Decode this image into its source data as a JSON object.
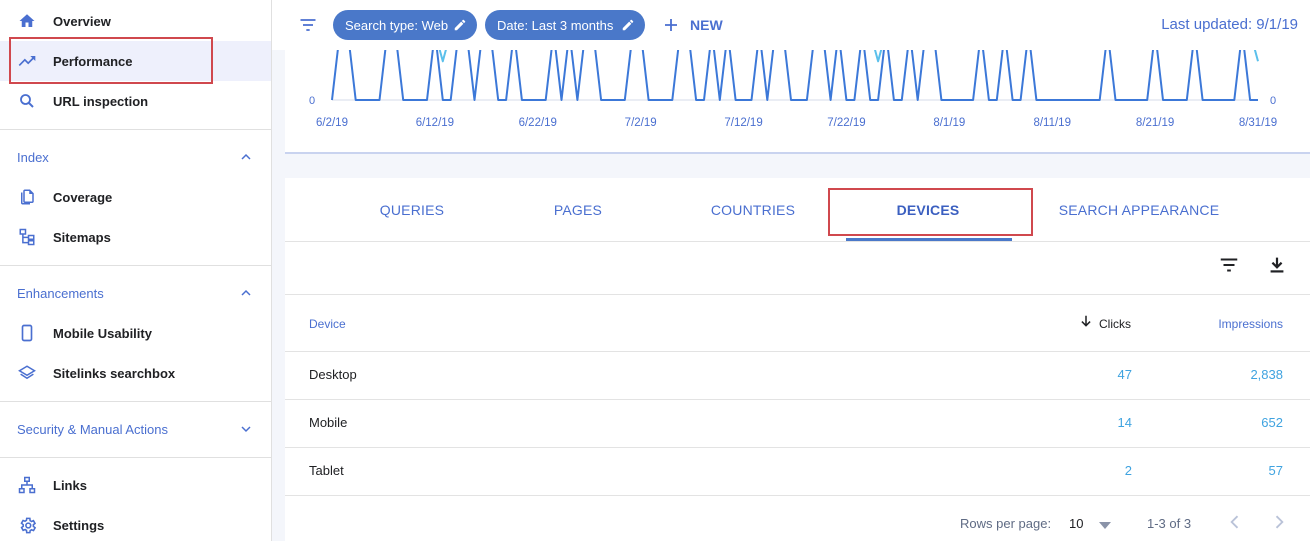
{
  "sidebar": {
    "items": [
      {
        "label": "Overview",
        "icon": "home-icon"
      },
      {
        "label": "Performance",
        "icon": "trending-up-icon"
      },
      {
        "label": "URL inspection",
        "icon": "search-icon"
      }
    ],
    "sections": [
      {
        "label": "Index",
        "items": [
          {
            "label": "Coverage",
            "icon": "file-copy-icon"
          },
          {
            "label": "Sitemaps",
            "icon": "sitemap-icon"
          }
        ]
      },
      {
        "label": "Enhancements",
        "items": [
          {
            "label": "Mobile Usability",
            "icon": "mobile-icon"
          },
          {
            "label": "Sitelinks searchbox",
            "icon": "layers-icon"
          }
        ]
      },
      {
        "label": "Security & Manual Actions",
        "items": []
      }
    ],
    "bottom": [
      {
        "label": "Links",
        "icon": "links-icon"
      },
      {
        "label": "Settings",
        "icon": "gear-icon"
      }
    ]
  },
  "topbar": {
    "chip_search_type": "Search type: Web",
    "chip_date": "Date: Last 3 months",
    "new_label": "NEW",
    "last_updated": "Last updated: 9/1/19"
  },
  "chart_data": {
    "type": "line",
    "x_tick_labels": [
      "6/2/19",
      "6/12/19",
      "6/22/19",
      "7/2/19",
      "7/12/19",
      "7/22/19",
      "8/1/19",
      "8/11/19",
      "8/21/19",
      "8/31/19"
    ],
    "y_left_tick": "0",
    "y_right_tick": "0",
    "series": [
      {
        "color": "#3c78d8",
        "values": [
          0,
          3,
          3,
          0,
          0,
          0,
          0,
          3,
          3,
          0,
          0,
          0,
          0,
          3,
          0,
          0,
          3,
          3,
          0,
          3,
          3,
          0,
          0,
          3,
          0,
          0,
          0,
          0,
          3,
          0,
          3,
          0,
          3,
          3,
          0,
          0,
          0,
          0,
          3,
          3,
          0,
          0,
          0,
          0,
          3,
          3,
          0,
          0,
          3,
          0,
          3,
          0,
          0,
          0,
          3,
          0,
          3,
          3,
          0,
          0,
          0,
          3,
          3,
          0,
          3,
          0,
          0,
          3,
          0,
          0,
          3,
          0,
          0,
          3,
          0,
          3,
          3,
          0,
          0,
          0,
          0,
          0,
          3,
          0,
          0,
          3,
          0,
          0,
          3,
          0,
          0,
          0,
          0,
          0,
          0,
          0,
          0,
          0,
          3,
          0,
          0,
          0,
          0,
          0,
          3,
          0,
          0,
          0,
          0,
          3,
          0,
          0,
          0,
          0,
          0,
          3,
          0,
          0
        ]
      },
      {
        "color": "#5bc0eb",
        "values": [
          3,
          3,
          3,
          3,
          2,
          3,
          3,
          3,
          2,
          3,
          3,
          2,
          3,
          3,
          1,
          3,
          3,
          3,
          3,
          3,
          3,
          2,
          3,
          3,
          3,
          3,
          3,
          3,
          3,
          3,
          3,
          3,
          3,
          3,
          3,
          3,
          2,
          3,
          2,
          3,
          3,
          3,
          3,
          3,
          3,
          3,
          3,
          3,
          3,
          2,
          3,
          3,
          3,
          3,
          3,
          3,
          3,
          3,
          3,
          3,
          3,
          2,
          3,
          3,
          3,
          3,
          3,
          3,
          3,
          1,
          3,
          3,
          3,
          3,
          3,
          3,
          3,
          3,
          3,
          3,
          3,
          3,
          3,
          3,
          3,
          3,
          3,
          3,
          3,
          3,
          3,
          3,
          3,
          3,
          3,
          3,
          3,
          3,
          3,
          3,
          3,
          3,
          3,
          3,
          3,
          3,
          3,
          3,
          2,
          3,
          3,
          2,
          3,
          3,
          3,
          3,
          3,
          1
        ]
      }
    ]
  },
  "tabs": [
    "QUERIES",
    "PAGES",
    "COUNTRIES",
    "DEVICES",
    "SEARCH APPEARANCE"
  ],
  "active_tab": "DEVICES",
  "table": {
    "headers": {
      "device": "Device",
      "clicks": "Clicks",
      "impressions": "Impressions"
    },
    "rows": [
      {
        "device": "Desktop",
        "clicks": "47",
        "impressions": "2,838"
      },
      {
        "device": "Mobile",
        "clicks": "14",
        "impressions": "652"
      },
      {
        "device": "Tablet",
        "clicks": "2",
        "impressions": "57"
      }
    ]
  },
  "pagination": {
    "rows_per_page_label": "Rows per page:",
    "rows_per_page_value": "10",
    "range": "1-3 of 3"
  },
  "colors": {
    "accent": "#4a78c9",
    "link": "#4a6fd0",
    "highlight_box": "#d0484e"
  }
}
